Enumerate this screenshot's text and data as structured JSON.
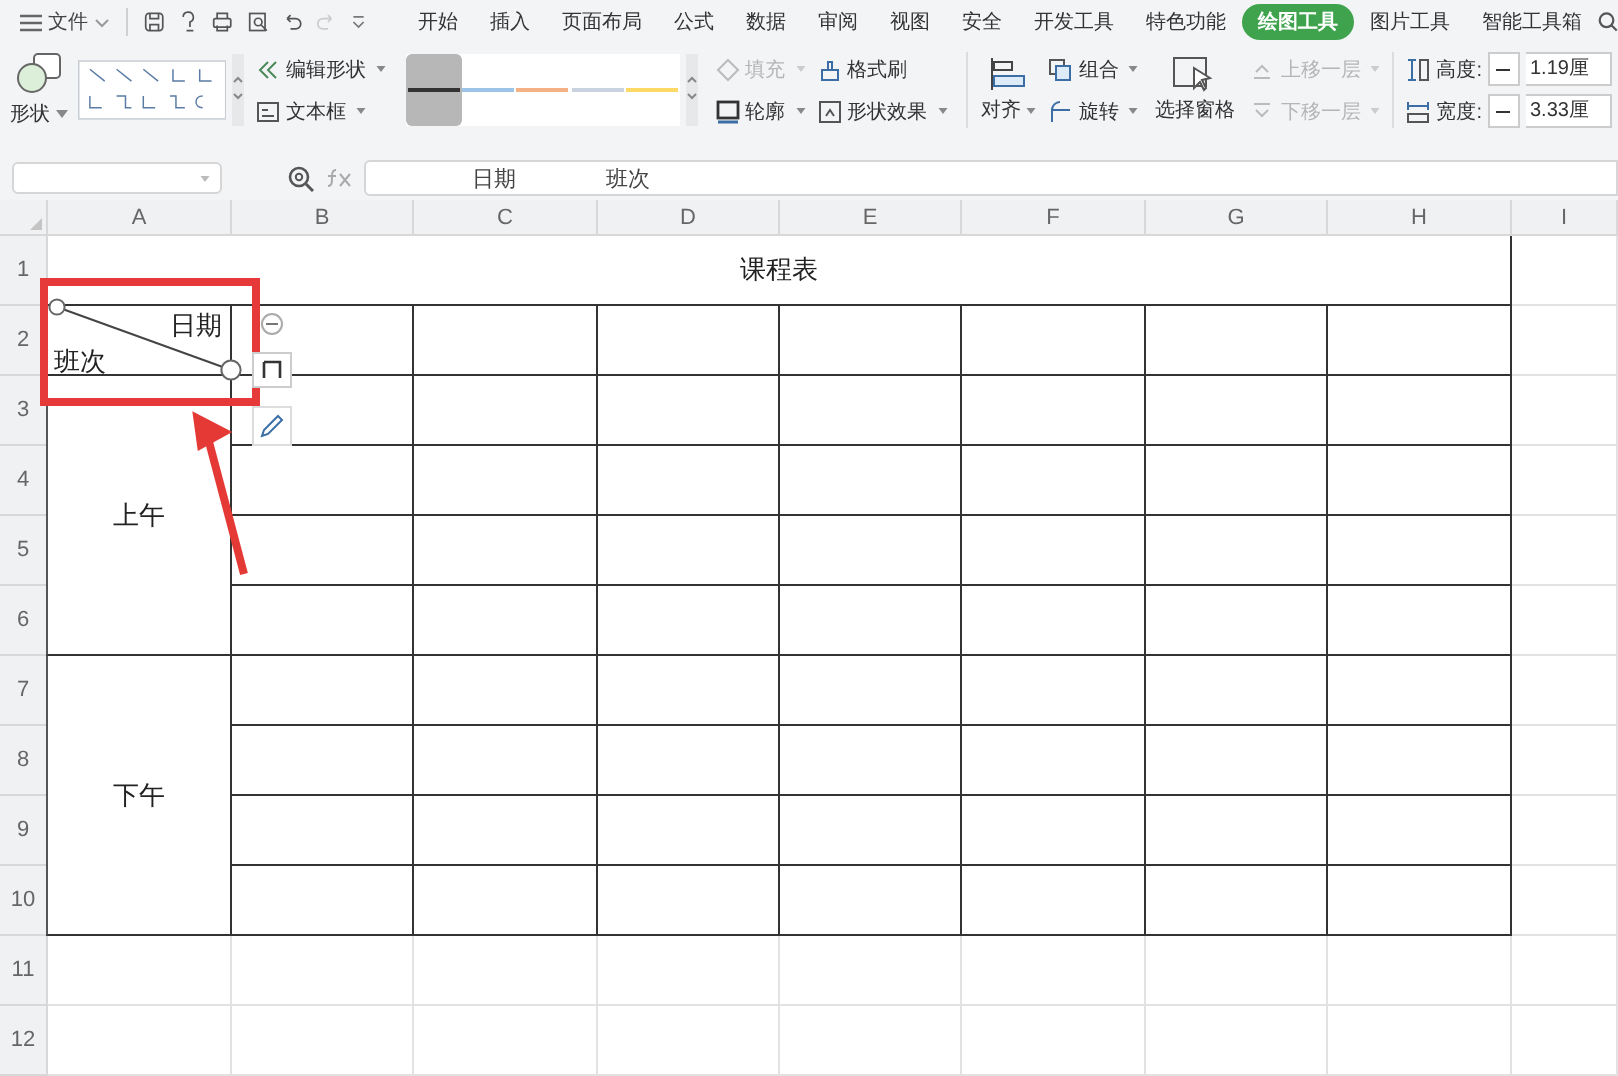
{
  "app_menu": {
    "label": "文件"
  },
  "tabs": [
    {
      "label": "开始",
      "selected": false
    },
    {
      "label": "插入",
      "selected": false
    },
    {
      "label": "页面布局",
      "selected": false
    },
    {
      "label": "公式",
      "selected": false
    },
    {
      "label": "数据",
      "selected": false
    },
    {
      "label": "审阅",
      "selected": false
    },
    {
      "label": "视图",
      "selected": false
    },
    {
      "label": "安全",
      "selected": false
    },
    {
      "label": "开发工具",
      "selected": false
    },
    {
      "label": "特色功能",
      "selected": false
    },
    {
      "label": "绘图工具",
      "selected": true
    },
    {
      "label": "图片工具",
      "selected": false
    },
    {
      "label": "智能工具箱",
      "selected": false
    }
  ],
  "ribbon": {
    "shape_button": "形状",
    "edit_shape": "编辑形状",
    "text_box": "文本框",
    "line_styles": [
      {
        "color": "#333333",
        "selected": true
      },
      {
        "color": "#9dc3e6",
        "selected": false
      },
      {
        "color": "#f4b183",
        "selected": false
      },
      {
        "color": "#c9d3e0",
        "selected": false
      },
      {
        "color": "#ffd966",
        "selected": false
      }
    ],
    "format_commands": [
      {
        "kind": "fill",
        "label": "填充",
        "disabled": true
      },
      {
        "kind": "painter",
        "label": "格式刷",
        "disabled": false
      },
      {
        "kind": "outline",
        "label": "轮廓",
        "disabled": false
      },
      {
        "kind": "effects",
        "label": "形状效果",
        "disabled": false
      }
    ],
    "align": "对齐",
    "group": "组合",
    "rotate": "旋转",
    "selection_pane": "选择窗格",
    "layer_commands": [
      {
        "kind": "forward",
        "label": "上移一层",
        "disabled": true
      },
      {
        "kind": "backward",
        "label": "下移一层",
        "disabled": true
      }
    ],
    "size": [
      {
        "kind": "height",
        "label": "高度:",
        "value": "1.19厘"
      },
      {
        "kind": "width",
        "label": "宽度:",
        "value": "3.33厘"
      }
    ]
  },
  "formula_bar": {
    "formula": [
      "日期",
      "班次"
    ]
  },
  "sheet": {
    "columns": [
      "A",
      "B",
      "C",
      "D",
      "E",
      "F",
      "G",
      "H",
      "I"
    ],
    "rows": [
      "1",
      "2",
      "3",
      "4",
      "5",
      "6",
      "7",
      "8",
      "9",
      "10",
      "11",
      "12"
    ],
    "title": "课程表",
    "corner_cell": {
      "top_right": "日期",
      "bottom_left": "班次"
    },
    "periods": [
      "上午",
      "下午"
    ]
  }
}
